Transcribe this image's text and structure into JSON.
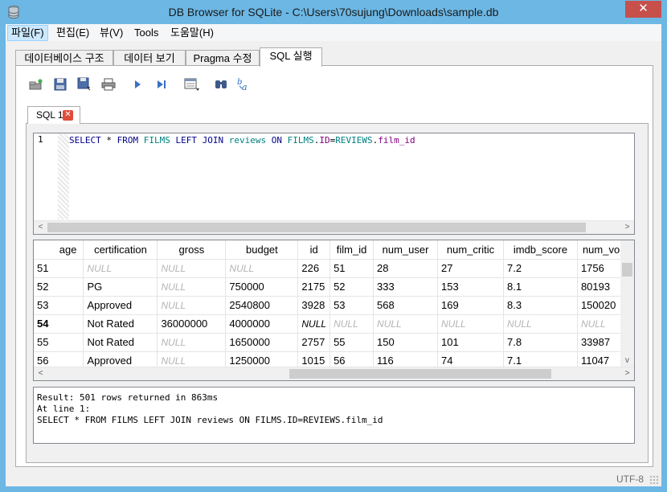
{
  "window": {
    "title": "DB Browser for SQLite - C:\\Users\\70sujung\\Downloads\\sample.db",
    "close_label": "✕"
  },
  "menu": [
    "파일(F)",
    "편집(E)",
    "뷰(V)",
    "Tools",
    "도움말(H)"
  ],
  "tabs": [
    "데이터베이스 구조",
    "데이터 보기",
    "Pragma 수정",
    "SQL 실행"
  ],
  "sql_tab": {
    "label": "SQL 1",
    "close": "✕"
  },
  "editor": {
    "line_number": "1"
  },
  "grid": {
    "columns": [
      "age",
      "certification",
      "gross",
      "budget",
      "id",
      "film_id",
      "num_user",
      "num_critic",
      "imdb_score",
      "num_vo"
    ],
    "rows": [
      {
        "n": "51",
        "cells": [
          "",
          "NULL",
          "NULL",
          "NULL",
          "226",
          "51",
          "28",
          "27",
          "7.2",
          "1756"
        ]
      },
      {
        "n": "52",
        "cells": [
          "",
          "PG",
          "NULL",
          "750000",
          "2175",
          "52",
          "333",
          "153",
          "8.1",
          "80193"
        ]
      },
      {
        "n": "53",
        "cells": [
          "",
          "Approved",
          "NULL",
          "2540800",
          "3928",
          "53",
          "568",
          "169",
          "8.3",
          "150020"
        ]
      },
      {
        "n": "54",
        "cells": [
          "",
          "Not Rated",
          "36000000",
          "4000000",
          "NULL",
          "NULL",
          "NULL",
          "NULL",
          "NULL",
          "NULL"
        ]
      },
      {
        "n": "55",
        "cells": [
          "",
          "Not Rated",
          "NULL",
          "1650000",
          "2757",
          "55",
          "150",
          "101",
          "7.8",
          "33987"
        ]
      },
      {
        "n": "56",
        "cells": [
          "",
          "Approved",
          "NULL",
          "1250000",
          "1015",
          "56",
          "116",
          "74",
          "7.1",
          "11047"
        ]
      }
    ]
  },
  "messages": {
    "line1": "Result: 501 rows returned in 863ms",
    "line2": "At line 1:",
    "line3": "SELECT * FROM FILMS LEFT JOIN reviews ON FILMS.ID=REVIEWS.film_id"
  },
  "status": {
    "encoding": "UTF-8"
  },
  "icons": [
    "open-tab-icon",
    "open-sql-icon",
    "save-sql-icon",
    "print-icon",
    "execute-icon",
    "execute-line-icon",
    "save-results-icon",
    "find-icon",
    "find-replace-icon"
  ]
}
